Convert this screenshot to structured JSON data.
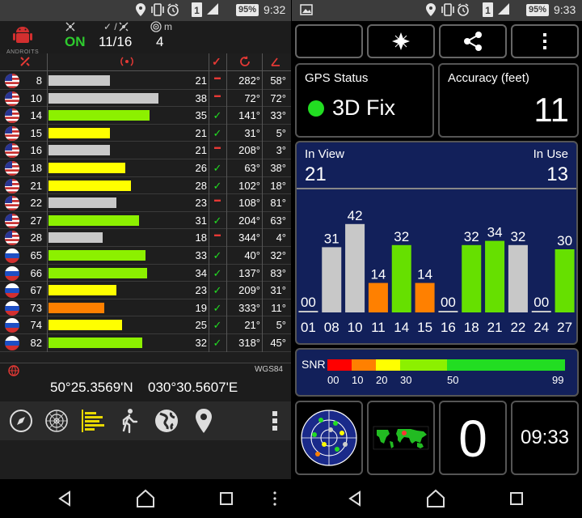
{
  "left": {
    "status_time": "9:32",
    "battery": "95%",
    "header": {
      "app_logo_text": "ANDROITS",
      "fix_state": "ON",
      "sats_used_total": "11/16",
      "sats_count": "4",
      "check_label": "✓ /",
      "m_label": "m"
    },
    "rows": [
      {
        "prn": "8",
        "snr": "21",
        "used": false,
        "az": "282°",
        "el": "58°",
        "flag": "us",
        "bar": 0.56,
        "color": "#c8c8c8"
      },
      {
        "prn": "10",
        "snr": "38",
        "used": false,
        "az": "72°",
        "el": "72°",
        "flag": "us",
        "bar": 1.0,
        "color": "#c8c8c8"
      },
      {
        "prn": "14",
        "snr": "35",
        "used": true,
        "az": "141°",
        "el": "33°",
        "flag": "us",
        "bar": 0.92,
        "color": "#8cf000"
      },
      {
        "prn": "15",
        "snr": "21",
        "used": true,
        "az": "31°",
        "el": "5°",
        "flag": "us",
        "bar": 0.56,
        "color": "#ffff00"
      },
      {
        "prn": "16",
        "snr": "21",
        "used": false,
        "az": "208°",
        "el": "3°",
        "flag": "us",
        "bar": 0.56,
        "color": "#c8c8c8"
      },
      {
        "prn": "18",
        "snr": "26",
        "used": true,
        "az": "63°",
        "el": "38°",
        "flag": "us",
        "bar": 0.7,
        "color": "#ffff00"
      },
      {
        "prn": "21",
        "snr": "28",
        "used": true,
        "az": "102°",
        "el": "18°",
        "flag": "us",
        "bar": 0.75,
        "color": "#ffff00"
      },
      {
        "prn": "22",
        "snr": "23",
        "used": false,
        "az": "108°",
        "el": "81°",
        "flag": "us",
        "bar": 0.62,
        "color": "#c8c8c8"
      },
      {
        "prn": "27",
        "snr": "31",
        "used": true,
        "az": "204°",
        "el": "63°",
        "flag": "us",
        "bar": 0.82,
        "color": "#8cf000"
      },
      {
        "prn": "28",
        "snr": "18",
        "used": false,
        "az": "344°",
        "el": "4°",
        "flag": "us",
        "bar": 0.49,
        "color": "#c8c8c8"
      },
      {
        "prn": "65",
        "snr": "33",
        "used": true,
        "az": "40°",
        "el": "32°",
        "flag": "ru",
        "bar": 0.88,
        "color": "#8cf000"
      },
      {
        "prn": "66",
        "snr": "34",
        "used": true,
        "az": "137°",
        "el": "83°",
        "flag": "ru",
        "bar": 0.9,
        "color": "#8cf000"
      },
      {
        "prn": "67",
        "snr": "23",
        "used": true,
        "az": "209°",
        "el": "31°",
        "flag": "ru",
        "bar": 0.62,
        "color": "#ffff00"
      },
      {
        "prn": "73",
        "snr": "19",
        "used": true,
        "az": "333°",
        "el": "11°",
        "flag": "ru",
        "bar": 0.51,
        "color": "#ff8000"
      },
      {
        "prn": "74",
        "snr": "25",
        "used": true,
        "az": "21°",
        "el": "5°",
        "flag": "ru",
        "bar": 0.67,
        "color": "#ffff00"
      },
      {
        "prn": "82",
        "snr": "32",
        "used": true,
        "az": "318°",
        "el": "45°",
        "flag": "ru",
        "bar": 0.85,
        "color": "#8cf000"
      }
    ],
    "datum": "WGS84",
    "lat": "50°25.3569'N",
    "lon": "030°30.5607'E"
  },
  "right": {
    "status_time": "9:33",
    "battery": "95%",
    "gps_status_label": "GPS Status",
    "gps_status_value": "3D Fix",
    "accuracy_label": "Accuracy (feet)",
    "accuracy_value": "11",
    "in_view_label": "In View",
    "in_view_value": "21",
    "in_use_label": "In Use",
    "in_use_value": "13",
    "snr_label": "SNR",
    "snr_ticks": [
      "00",
      "10",
      "20",
      "30",
      "50",
      "99"
    ],
    "speed_value": "0",
    "clock_value": "09:33",
    "chart_data": {
      "type": "bar",
      "categories": [
        "01",
        "08",
        "10",
        "11",
        "14",
        "15",
        "16",
        "18",
        "21",
        "22",
        "24",
        "27"
      ],
      "values": [
        0,
        31,
        42,
        14,
        32,
        14,
        0,
        32,
        34,
        32,
        0,
        30
      ],
      "value_labels": [
        "00",
        "31",
        "42",
        "14",
        "32",
        "14",
        "00",
        "32",
        "34",
        "32",
        "00",
        "30"
      ],
      "colors": [
        "#c8c8c8",
        "#c8c8c8",
        "#c8c8c8",
        "#ff8000",
        "#66e000",
        "#ff8000",
        "#c8c8c8",
        "#66e000",
        "#66e000",
        "#c8c8c8",
        "#c8c8c8",
        "#66e000"
      ],
      "ylim": [
        0,
        50
      ]
    }
  }
}
